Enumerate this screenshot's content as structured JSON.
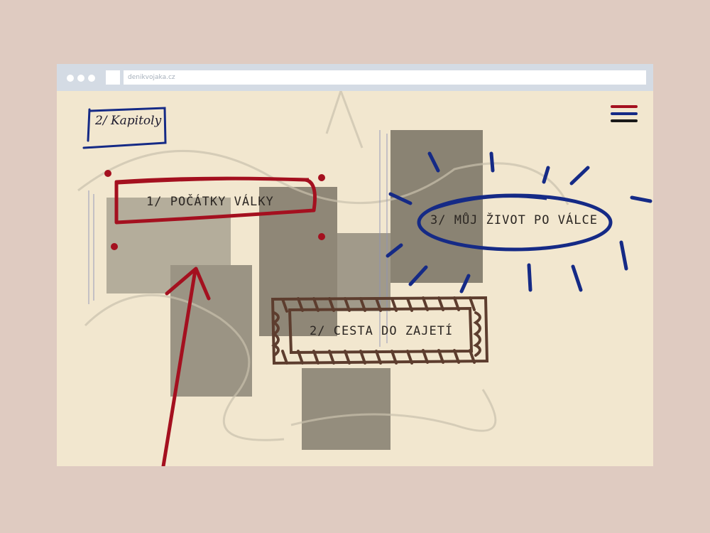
{
  "browser": {
    "url": "denikvojaka.cz"
  },
  "header": {
    "section_label": "2/ Kapitoly"
  },
  "chapters": [
    {
      "label": "1/ POČÁTKY VÁLKY",
      "color": "#a4101f"
    },
    {
      "label": "2/ CESTA DO ZAJETÍ",
      "color": "#5d3d2e"
    },
    {
      "label": "3/ MŮJ ŽIVOT PO VÁLCE",
      "color": "#152a86"
    }
  ],
  "colors": {
    "red": "#a4101f",
    "blue": "#152a86",
    "brown": "#5d3d2e",
    "dark": "#1a1a1a",
    "paper": "#f2e7cf"
  }
}
